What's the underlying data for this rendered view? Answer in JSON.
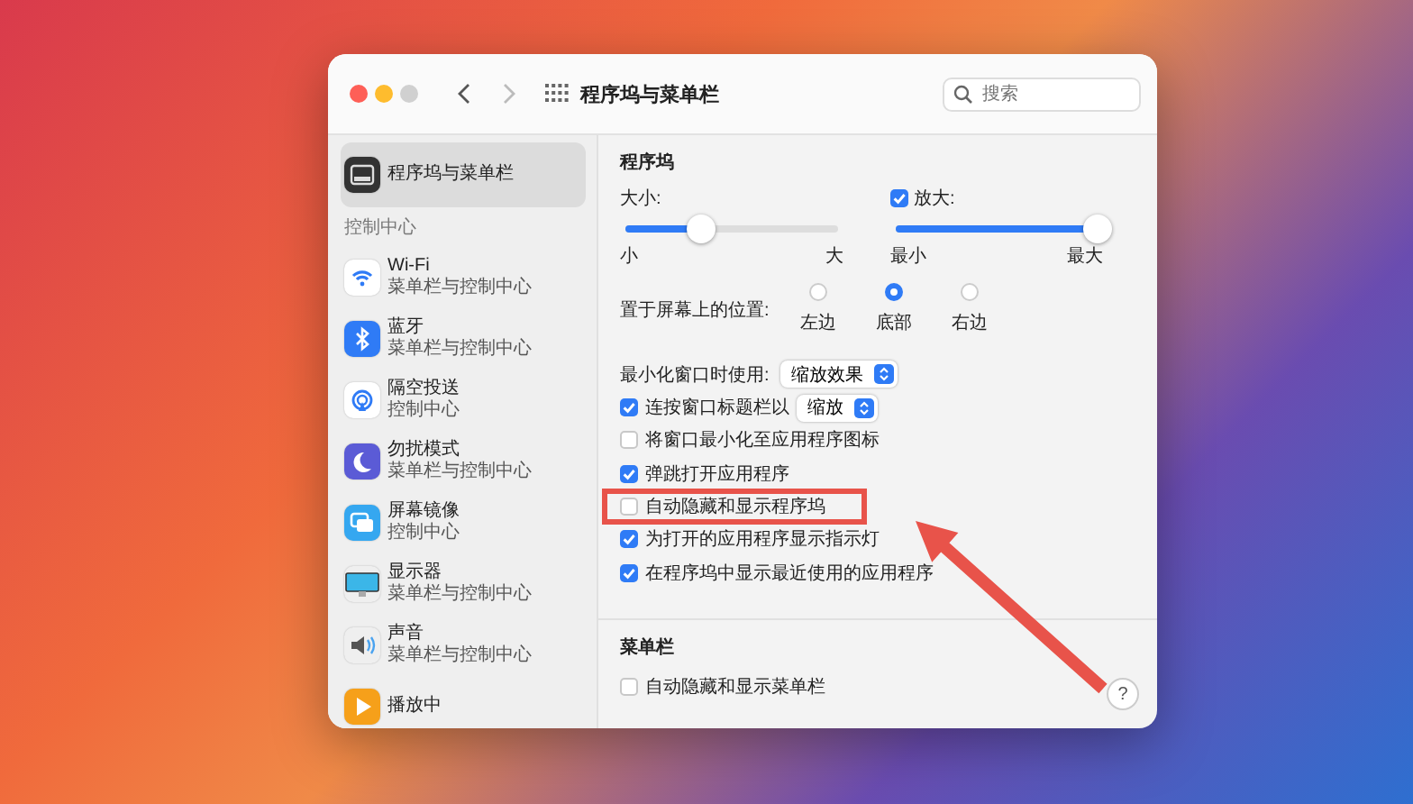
{
  "window": {
    "title": "程序坞与菜单栏",
    "search": {
      "placeholder": "搜索"
    }
  },
  "sidebar": {
    "items": [
      {
        "label": "程序坞与菜单栏",
        "selected": true
      }
    ],
    "section": {
      "title": "控制中心",
      "items": [
        {
          "label": "Wi-Fi",
          "subtitle": "菜单栏与控制中心",
          "selected": false
        },
        {
          "label": "蓝牙",
          "subtitle": "菜单栏与控制中心",
          "selected": false
        },
        {
          "label": "隔空投送",
          "subtitle": "控制中心",
          "selected": false
        },
        {
          "label": "勿扰模式",
          "subtitle": "菜单栏与控制中心",
          "selected": false
        },
        {
          "label": "屏幕镜像",
          "subtitle": "控制中心",
          "selected": false
        },
        {
          "label": "显示器",
          "subtitle": "菜单栏与控制中心",
          "selected": false
        },
        {
          "label": "声音",
          "subtitle": "菜单栏与控制中心",
          "selected": false
        },
        {
          "label": "播放中",
          "selected": false
        }
      ]
    }
  },
  "dock": {
    "title": "程序坞",
    "size": {
      "label": "大小:",
      "level": 0.36,
      "min_label": "小",
      "max_label": "大"
    },
    "magnification": {
      "label": "放大:",
      "checked": true,
      "level": 1.0,
      "min_label": "最小",
      "max_label": "最大"
    },
    "position": {
      "label": "置于屏幕上的位置:",
      "options": [
        {
          "label": "左边",
          "selected": false
        },
        {
          "label": "底部",
          "selected": true
        },
        {
          "label": "右边",
          "selected": false
        }
      ]
    },
    "minimize": {
      "label": "最小化窗口时使用:",
      "value": "缩放效果"
    },
    "options": [
      {
        "kind": "select",
        "label": "连按窗口标题栏以",
        "checked": true,
        "value": "缩放",
        "highlighted": false
      },
      {
        "kind": "checkbox",
        "label": "将窗口最小化至应用程序图标",
        "checked": false,
        "highlighted": false
      },
      {
        "kind": "checkbox",
        "label": "弹跳打开应用程序",
        "checked": true,
        "highlighted": false
      },
      {
        "kind": "checkbox",
        "label": "自动隐藏和显示程序坞",
        "checked": false,
        "highlighted": true
      },
      {
        "kind": "checkbox",
        "label": "为打开的应用程序显示指示灯",
        "checked": true,
        "highlighted": false
      },
      {
        "kind": "checkbox",
        "label": "在程序坞中显示最近使用的应用程序",
        "checked": true,
        "highlighted": false
      }
    ]
  },
  "menu_bar": {
    "title": "菜单栏",
    "options": [
      {
        "kind": "checkbox",
        "label": "自动隐藏和显示菜单栏",
        "checked": false,
        "highlighted": false
      }
    ]
  },
  "help_button": {
    "label": "?"
  }
}
